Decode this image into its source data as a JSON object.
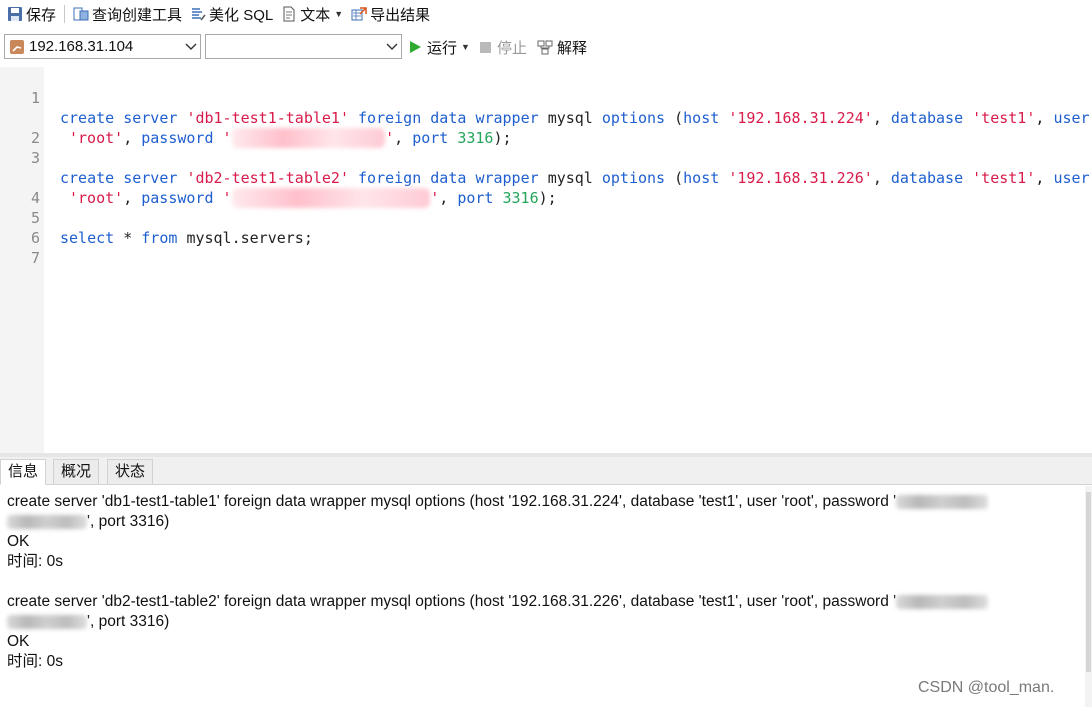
{
  "toolbar": {
    "save": "保存",
    "query_builder": "查询创建工具",
    "beautify_sql": "美化 SQL",
    "text": "文本",
    "export_results": "导出结果"
  },
  "connection_select": {
    "value": "192.168.31.104"
  },
  "database_select": {
    "value": ""
  },
  "run": {
    "run": "运行",
    "stop": "停止",
    "explain": "解释"
  },
  "editor": {
    "line_numbers": [
      "1",
      "",
      "2",
      "3",
      "",
      "4",
      "5",
      "6",
      "7"
    ],
    "line1": {
      "create": "create",
      "server": "server",
      "name": "'db1-test1-table1'",
      "foreign": "foreign",
      "data": "data",
      "wrapper": "wrapper",
      "mysql": "mysql",
      "options": "options",
      "paren": "(",
      "host": "host",
      "host_val": "'192.168.31.224'",
      "comma1": ",",
      "database": "database",
      "db_val": "'test1'",
      "comma2": ",",
      "user": "user"
    },
    "line1_wrap": {
      "user_val": "'root'",
      "comma": ",",
      "password": "password",
      "pw_open": "'",
      "pw_masked": "xxxxxxxxxxxxxxxxx",
      "pw_close": "'",
      "comma2": ",",
      "port": "port",
      "port_val": "3316",
      "end": ");"
    },
    "line3": {
      "create": "create",
      "server": "server",
      "name": "'db2-test1-table2'",
      "foreign": "foreign",
      "data": "data",
      "wrapper": "wrapper",
      "mysql": "mysql",
      "options": "options",
      "paren": "(",
      "host": "host",
      "host_val": "'192.168.31.226'",
      "comma1": ",",
      "database": "database",
      "db_val": "'test1'",
      "comma2": ",",
      "user": "user"
    },
    "line3_wrap": {
      "user_val": "'root'",
      "comma": ",",
      "password": "password",
      "pw_open": "'",
      "pw_masked": "xxxxxxxxxxxxxxxxxxxxxx",
      "pw_close": "'",
      "comma2": ",",
      "port": "port",
      "port_val": "3316",
      "end": ");"
    },
    "line5": {
      "select": "select",
      "star": "*",
      "from": "from",
      "table": "mysql.servers;"
    }
  },
  "tabs": [
    "信息",
    "概况",
    "状态"
  ],
  "results": {
    "r1_line1": "create server 'db1-test1-table1' foreign data wrapper mysql options (host '192.168.31.224', database 'test1', user 'root', password '",
    "r1_line2_tail": "', port 3316)",
    "r1_ok": "OK",
    "r1_time": "时间: 0s",
    "r2_line1": "create server 'db2-test1-table2' foreign data wrapper mysql options (host '192.168.31.226', database 'test1', user 'root', password '",
    "r2_line2_tail": "', port 3316)",
    "r2_ok": "OK",
    "r2_time": "时间: 0s"
  },
  "watermark": "CSDN @tool_man."
}
